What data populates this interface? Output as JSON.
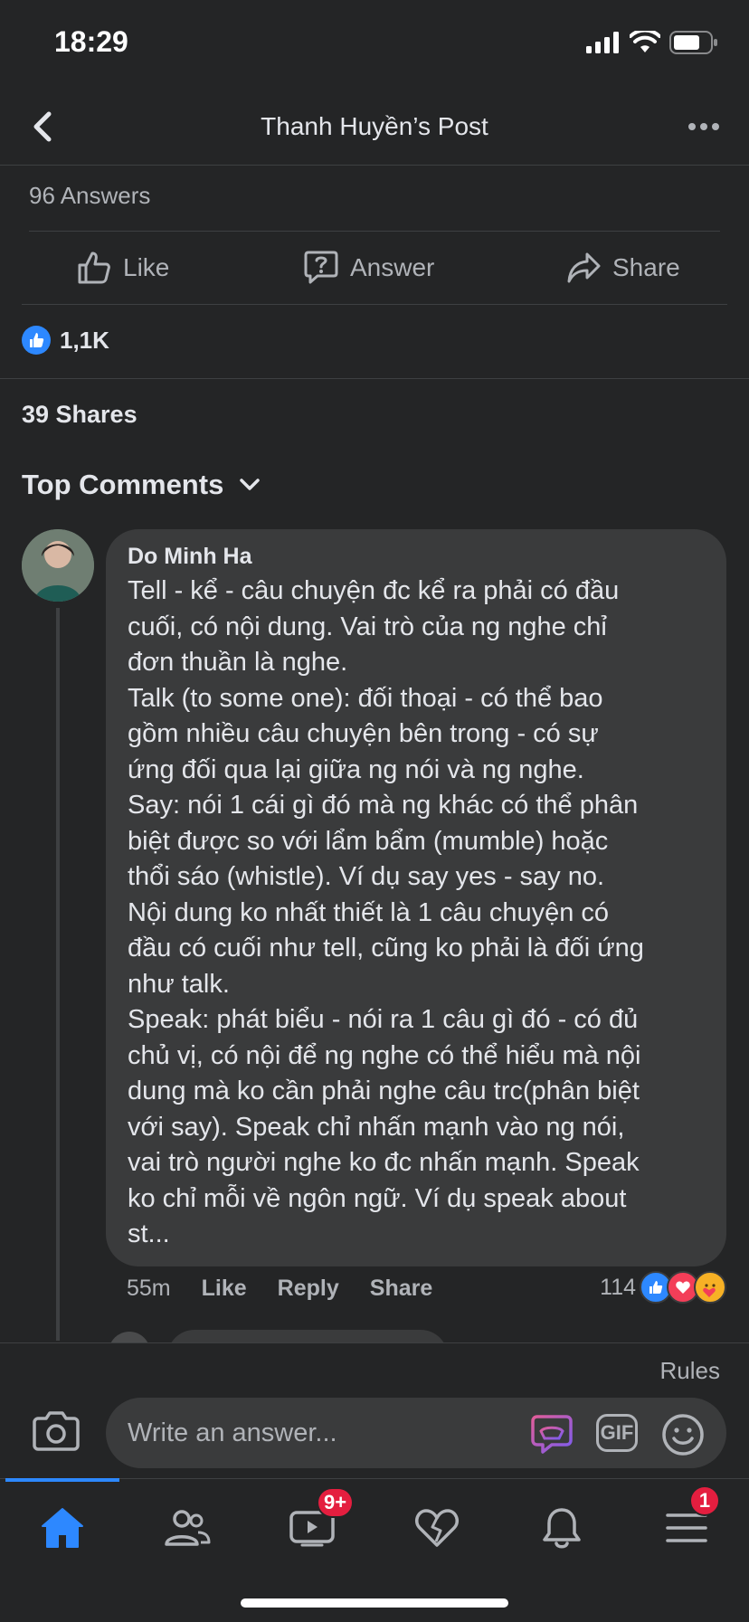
{
  "status_bar": {
    "time": "18:29"
  },
  "header": {
    "title": "Thanh Huyền’s Post"
  },
  "post": {
    "answers_count": "96 Answers",
    "actions": {
      "like": "Like",
      "answer": "Answer",
      "share": "Share"
    },
    "reaction_count": "1,1K",
    "shares": "39 Shares"
  },
  "comments": {
    "sort_label": "Top Comments",
    "top": {
      "author": "Do Minh Ha",
      "text": "Tell - kể - câu chuyện đc kể ra phải có đầu\ncuối, có nội dung. Vai trò của ng nghe chỉ\nđơn thuần là nghe.\nTalk (to some one): đối thoại - có thể bao\ngồm nhiều câu chuyện bên trong - có sự\nứng đối qua lại giữa ng nói và ng nghe.\nSay: nói 1 cái gì đó mà ng khác có thể phân\nbiệt được so với lẩm bẩm (mumble) hoặc\nthổi sáo (whistle). Ví dụ say yes - say no.\nNội dung ko nhất thiết là 1 câu chuyện có\nđầu có cuối như tell, cũng ko phải là đối ứng\nnhư talk.\nSpeak: phát biểu - nói ra 1 câu gì đó - có đủ\nchủ vị, có nội để ng nghe có thể hiểu mà nội\ndung mà ko cần phải nghe câu trc(phân biệt\nvới say). Speak chỉ nhấn mạnh vào ng nói,\nvai trò người nghe ko đc nhấn mạnh. Speak\nko chỉ mỗi về ngôn ngữ. Ví dụ speak about\nst...",
      "time": "55m",
      "like": "Like",
      "reply": "Reply",
      "share": "Share",
      "reaction_count": "114"
    }
  },
  "composer": {
    "rules": "Rules",
    "placeholder": "Write an answer...",
    "gif_label": "GIF"
  },
  "tabbar": {
    "watch_badge": "9+",
    "menu_badge": "1"
  },
  "colors": {
    "background": "#242526",
    "bubble": "#3a3b3c",
    "accent": "#2d88ff",
    "badge": "#e41e3f"
  }
}
